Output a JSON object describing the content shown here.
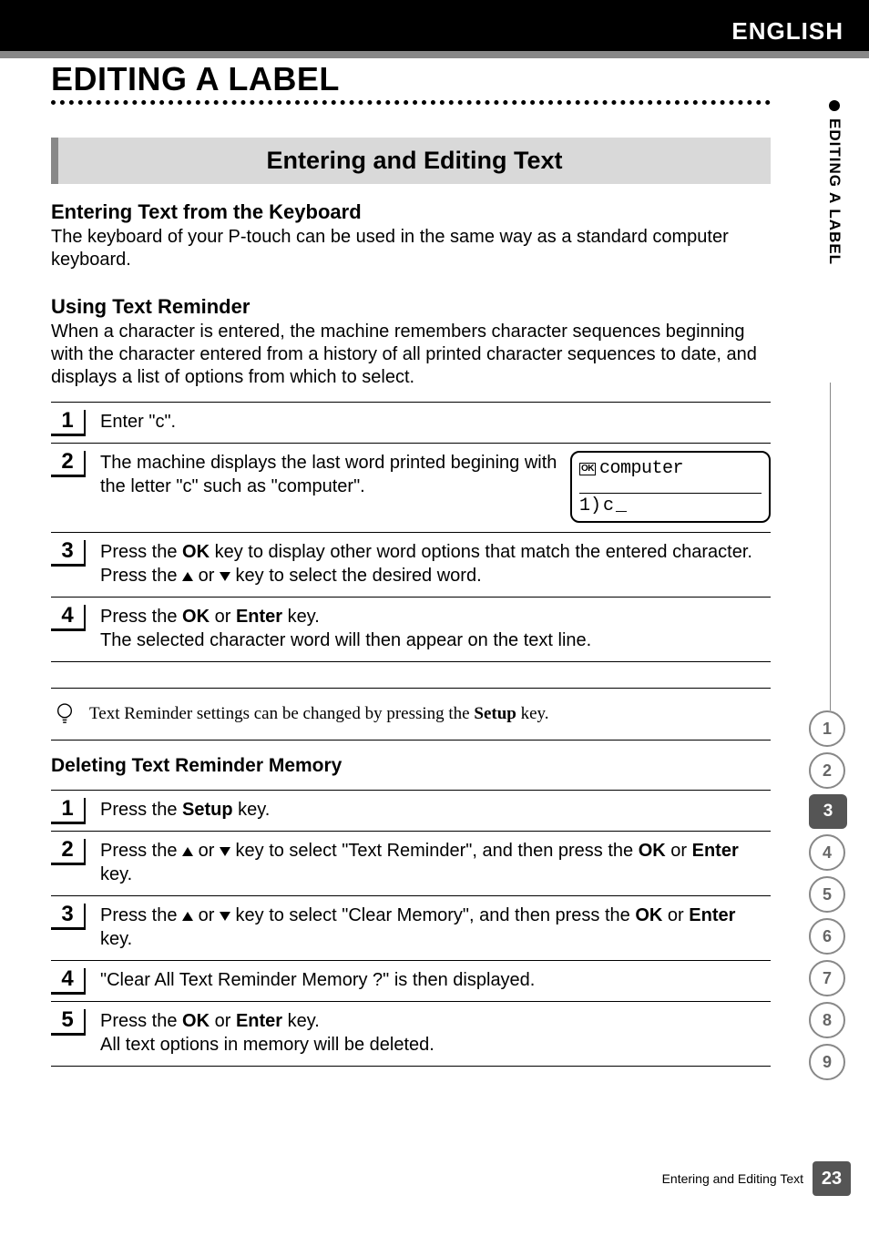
{
  "header": {
    "language": "ENGLISH"
  },
  "chapter": {
    "title": "EDITING A LABEL"
  },
  "side_tab": {
    "label": "EDITING A LABEL"
  },
  "section": {
    "banner": "Entering and Editing Text"
  },
  "entering_keyboard": {
    "heading": "Entering Text from the Keyboard",
    "body": "The keyboard of your P-touch can be used in the same way as a standard computer keyboard."
  },
  "text_reminder": {
    "heading": "Using Text Reminder",
    "body": "When a character is entered, the machine remembers character sequences beginning with the character entered from a history of all printed character sequences to date, and displays a list of options from which to select."
  },
  "steps_a": {
    "1": {
      "text": "Enter \"c\"."
    },
    "2": {
      "text": "The machine displays the last word printed begining with the letter \"c\" such as \"computer\".",
      "lcd_word": "computer",
      "lcd_line2_prefix": "1)",
      "lcd_line2_char": "c"
    },
    "3": {
      "t1": "Press the ",
      "ok": "OK",
      "t2": " key to display other word options that match the entered character.",
      "t3": "Press the ",
      "t4": " or ",
      "t5": " key to select the desired word."
    },
    "4": {
      "t1": "Press the ",
      "ok": "OK",
      "t2": " or ",
      "enter": "Enter",
      "t3": " key.",
      "t4": "The selected character word will then appear on the text line."
    }
  },
  "note": {
    "t1": "Text Reminder settings can be changed by pressing the ",
    "setup": "Setup",
    "t2": " key."
  },
  "delete_memory": {
    "heading": "Deleting Text Reminder Memory"
  },
  "steps_b": {
    "1": {
      "t1": "Press the ",
      "setup": "Setup",
      "t2": " key."
    },
    "2": {
      "t1": "Press the ",
      "t2": " or ",
      "t3": " key to select \"Text Reminder\", and then press the ",
      "ok": "OK",
      "t4": " or ",
      "enter": "Enter",
      "t5": " key."
    },
    "3": {
      "t1": "Press the ",
      "t2": " or ",
      "t3": " key to select \"Clear Memory\", and then press the ",
      "ok": "OK",
      "t4": " or ",
      "enter": "Enter",
      "t5": " key."
    },
    "4": {
      "text": "\"Clear All Text Reminder Memory ?\" is then displayed."
    },
    "5": {
      "t1": "Press the ",
      "ok": "OK",
      "t2": " or ",
      "enter": "Enter",
      "t3": " key.",
      "t4": "All text options in memory will be deleted."
    }
  },
  "index": {
    "items": [
      "1",
      "2",
      "3",
      "4",
      "5",
      "6",
      "7",
      "8",
      "9"
    ],
    "active": "3"
  },
  "footer": {
    "text": "Entering and Editing Text",
    "page": "23"
  }
}
